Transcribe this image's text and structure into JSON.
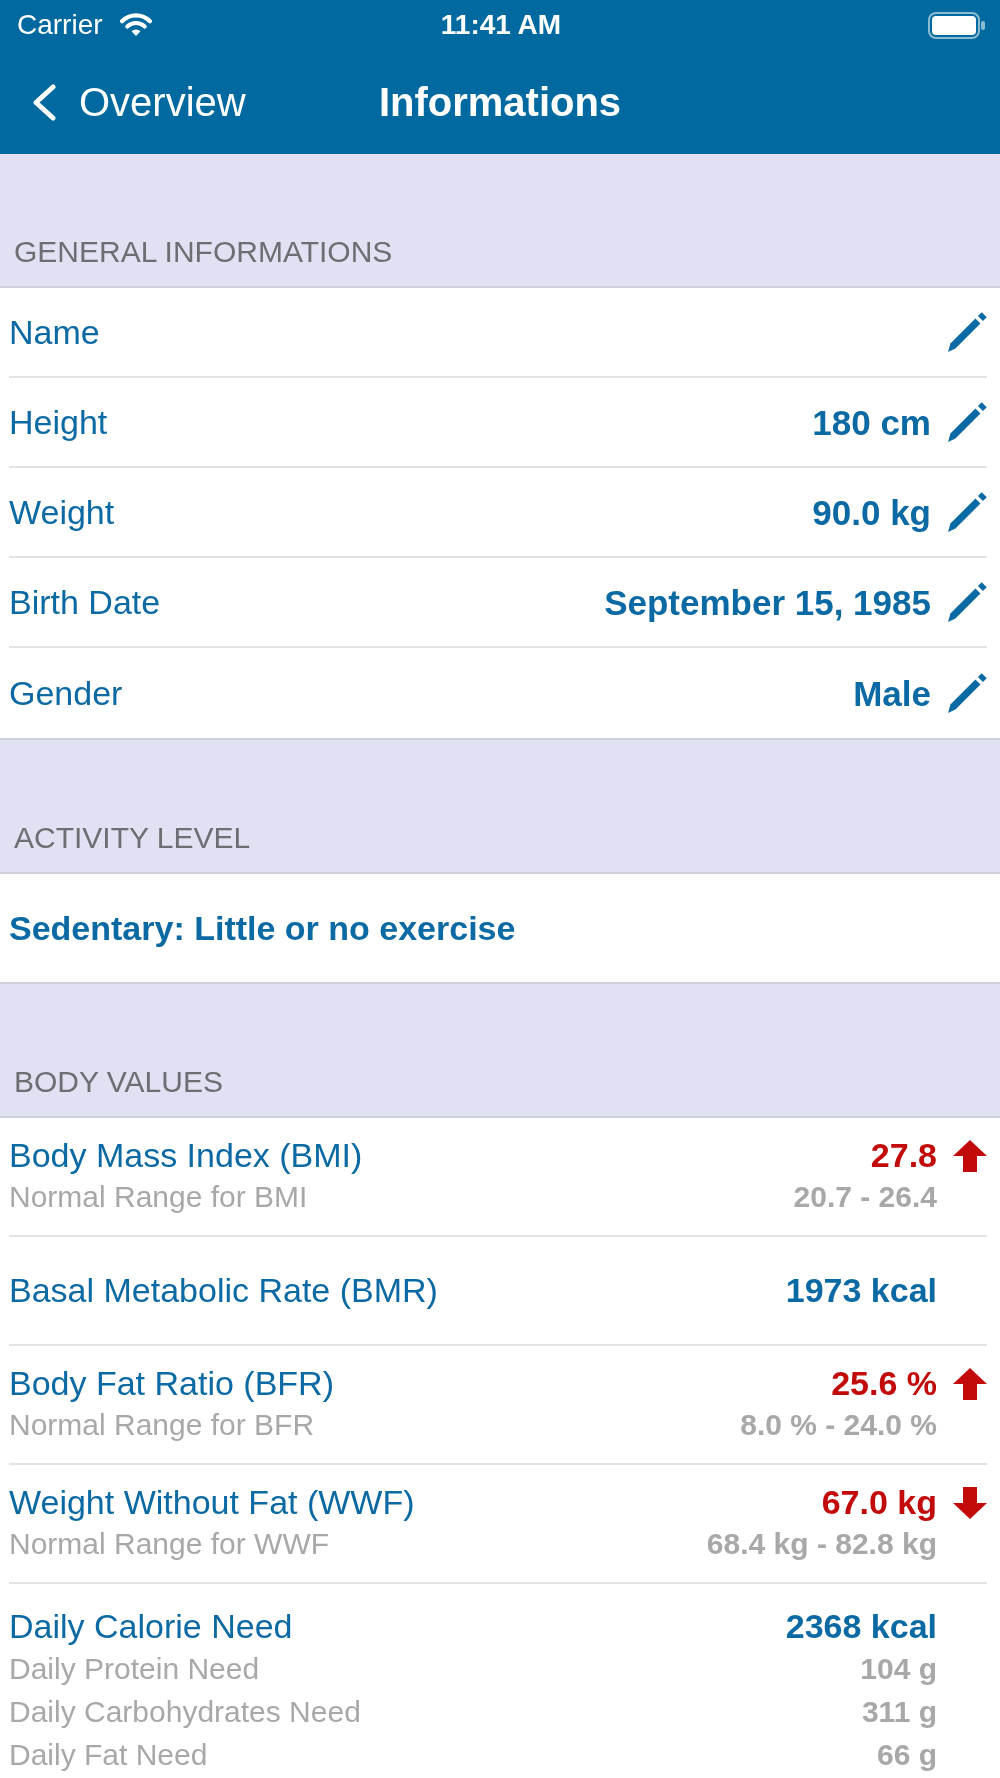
{
  "status_bar": {
    "carrier": "Carrier",
    "time": "11:41 AM"
  },
  "nav_bar": {
    "back": "Overview",
    "title": "Informations"
  },
  "sections": [
    {
      "header": "GENERAL INFORMATIONS",
      "kind": "editable",
      "rows": [
        {
          "label": "Name"
        },
        {
          "label": "Height",
          "value": "180 cm"
        },
        {
          "label": "Weight",
          "value": "90.0 kg"
        },
        {
          "label": "Birth Date",
          "value": "September 15, 1985"
        },
        {
          "label": "Gender",
          "value": "Male"
        }
      ]
    },
    {
      "header": "ACTIVITY LEVEL",
      "kind": "option",
      "rows": [
        {
          "label": "Sedentary: Little or no exercise"
        }
      ]
    },
    {
      "header": "BODY VALUES",
      "kind": "metrics",
      "rows": [
        {
          "label": "Body Mass Index (BMI)",
          "value": "27.8",
          "kind": "high",
          "details": [
            {
              "label": "Normal Range for BMI",
              "value": "20.7 - 26.4"
            }
          ]
        },
        {
          "label": "Basal Metabolic Rate (BMR)",
          "value": "1973 kcal",
          "kind": "normal"
        },
        {
          "label": "Body Fat Ratio (BFR)",
          "value": "25.6 %",
          "kind": "high",
          "details": [
            {
              "label": "Normal Range for BFR",
              "value": "8.0 % - 24.0 %"
            }
          ]
        },
        {
          "label": "Weight Without Fat (WWF)",
          "value": "67.0 kg",
          "kind": "low",
          "details": [
            {
              "label": "Normal Range for WWF",
              "value": "68.4 kg - 82.8 kg"
            }
          ]
        },
        {
          "label": "Daily Calorie Need",
          "value": "2368 kcal",
          "kind": "normal",
          "details": [
            {
              "label": "Daily Protein Need",
              "value": "104 g"
            },
            {
              "label": "Daily Carbohydrates Need",
              "value": "311 g"
            },
            {
              "label": "Daily Fat Need",
              "value": "66 g"
            }
          ]
        }
      ]
    }
  ]
}
